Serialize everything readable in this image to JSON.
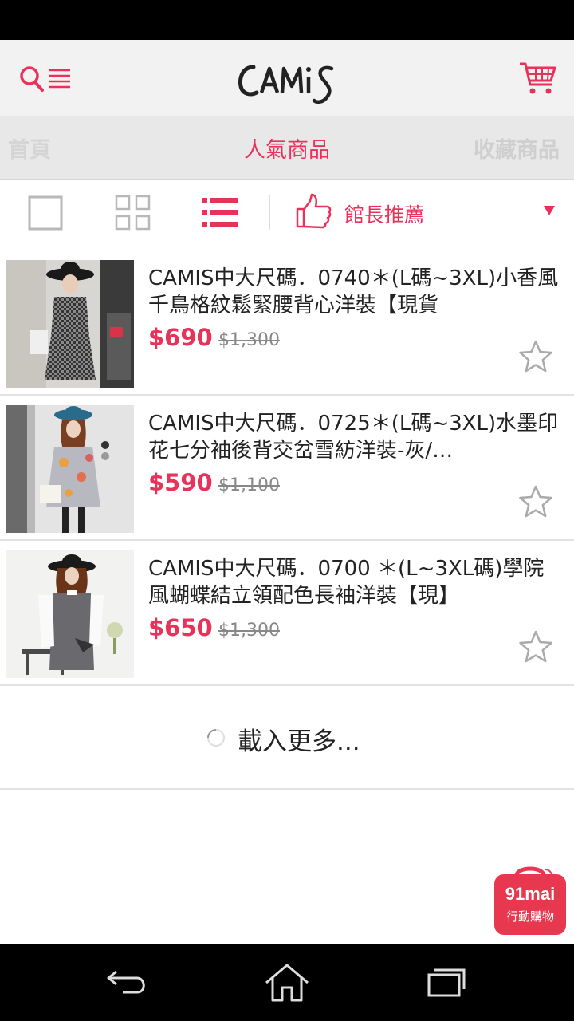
{
  "header": {
    "logo_text": "CAMiS",
    "search_icon": "search-icon",
    "menu_icon": "menu-icon",
    "cart_icon": "cart-icon"
  },
  "tabs": [
    {
      "label": "首頁"
    },
    {
      "label": "人氣商品",
      "active": true
    },
    {
      "label": "收藏商品"
    }
  ],
  "toolbar": {
    "views": [
      "single-view-icon",
      "grid-view-icon",
      "list-view-icon"
    ],
    "active_view": "list",
    "sort_label": "館長推薦",
    "sort_icon": "thumbs-up-icon"
  },
  "products": [
    {
      "title": "CAMIS中大尺碼．0740＊(L碼~3XL)小香風千鳥格紋鬆緊腰背心洋裝【現貨",
      "price": "$690",
      "original_price": "$1,300"
    },
    {
      "title": "CAMIS中大尺碼．0725＊(L碼~3XL)水墨印花七分袖後背交岔雪紡洋裝-灰/…",
      "price": "$590",
      "original_price": "$1,100"
    },
    {
      "title": "CAMIS中大尺碼．0700 ＊(L~3XL碼)學院風蝴蝶結立領配色長袖洋裝【現】",
      "price": "$650",
      "original_price": "$1,300"
    }
  ],
  "load_more": {
    "label": "載入更多..."
  },
  "badge": {
    "line1": "91mai",
    "line2": "行動購物"
  },
  "colors": {
    "accent": "#e8325a",
    "header_bg": "#f2f2f2",
    "tab_bg": "#e8e8e8"
  }
}
